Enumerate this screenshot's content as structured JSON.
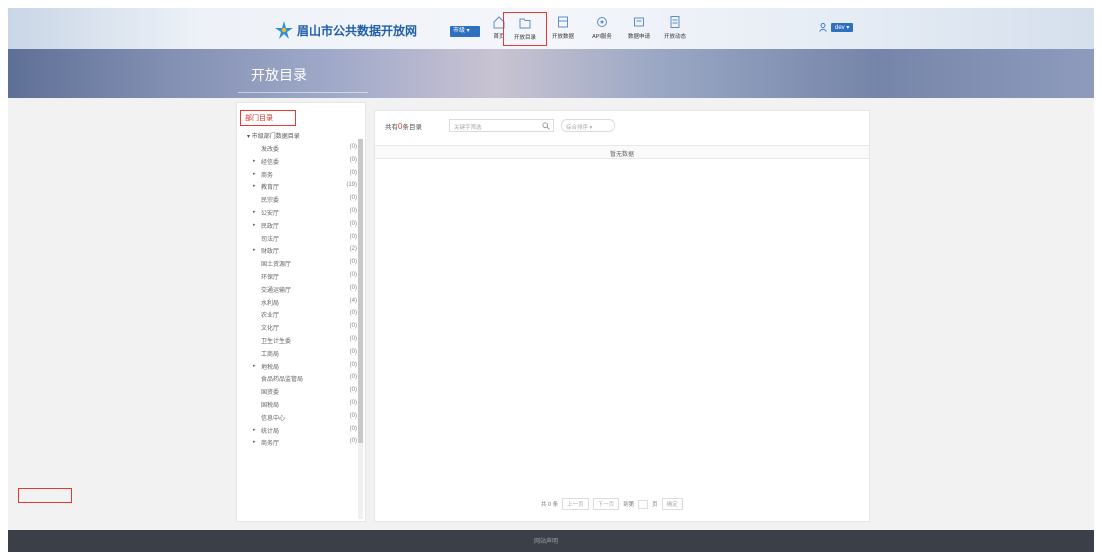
{
  "header": {
    "site_name": "眉山市公共数据开放网",
    "city_select": "市级",
    "nav": [
      {
        "label": "首页",
        "icon": "home-icon"
      },
      {
        "label": "开放目录",
        "icon": "folder-icon"
      },
      {
        "label": "开放数据",
        "icon": "database-icon"
      },
      {
        "label": "API服务",
        "icon": "api-icon"
      },
      {
        "label": "数据申请",
        "icon": "request-icon"
      },
      {
        "label": "开放动态",
        "icon": "news-icon"
      }
    ],
    "user": "dev"
  },
  "banner": {
    "title": "开放目录"
  },
  "sidebar": {
    "heading": "部门目录",
    "root": "市级部门数据目录",
    "items": [
      {
        "name": "发改委",
        "count": "(0)",
        "expandable": false
      },
      {
        "name": "经信委",
        "count": "(0)",
        "expandable": true
      },
      {
        "name": "商务",
        "count": "(0)",
        "expandable": true
      },
      {
        "name": "教育厅",
        "count": "(19)",
        "expandable": true
      },
      {
        "name": "民宗委",
        "count": "(0)",
        "expandable": false
      },
      {
        "name": "公安厅",
        "count": "(0)",
        "expandable": true
      },
      {
        "name": "民政厅",
        "count": "(0)",
        "expandable": true
      },
      {
        "name": "司法厅",
        "count": "(0)",
        "expandable": false
      },
      {
        "name": "财政厅",
        "count": "(2)",
        "expandable": true
      },
      {
        "name": "国土资源厅",
        "count": "(0)",
        "expandable": false
      },
      {
        "name": "环保厅",
        "count": "(0)",
        "expandable": false
      },
      {
        "name": "交通运输厅",
        "count": "(0)",
        "expandable": false
      },
      {
        "name": "水利局",
        "count": "(4)",
        "expandable": false
      },
      {
        "name": "农业厅",
        "count": "(0)",
        "expandable": false
      },
      {
        "name": "文化厅",
        "count": "(0)",
        "expandable": false
      },
      {
        "name": "卫生计生委",
        "count": "(0)",
        "expandable": false
      },
      {
        "name": "工商局",
        "count": "(0)",
        "expandable": false
      },
      {
        "name": "地税局",
        "count": "(0)",
        "expandable": true
      },
      {
        "name": "食品药品监管局",
        "count": "(0)",
        "expandable": false
      },
      {
        "name": "国资委",
        "count": "(0)",
        "expandable": false
      },
      {
        "name": "国税局",
        "count": "(0)",
        "expandable": false
      },
      {
        "name": "信息中心",
        "count": "(0)",
        "expandable": false
      },
      {
        "name": "统计局",
        "count": "(0)",
        "expandable": true
      },
      {
        "name": "商务厅",
        "count": "(0)",
        "expandable": true
      }
    ]
  },
  "main": {
    "count_prefix": "共有",
    "count_value": "0",
    "count_suffix": "条目录",
    "search_placeholder": "关键字筛选",
    "sort_placeholder": "综合排序",
    "empty_text": "暂无数据",
    "pager": {
      "total": "共 0 条",
      "prev": "上一页",
      "next": "下一页",
      "goto": "到第",
      "page_unit": "页",
      "confirm": "确定"
    }
  },
  "footer": {
    "text": "网站声明"
  }
}
